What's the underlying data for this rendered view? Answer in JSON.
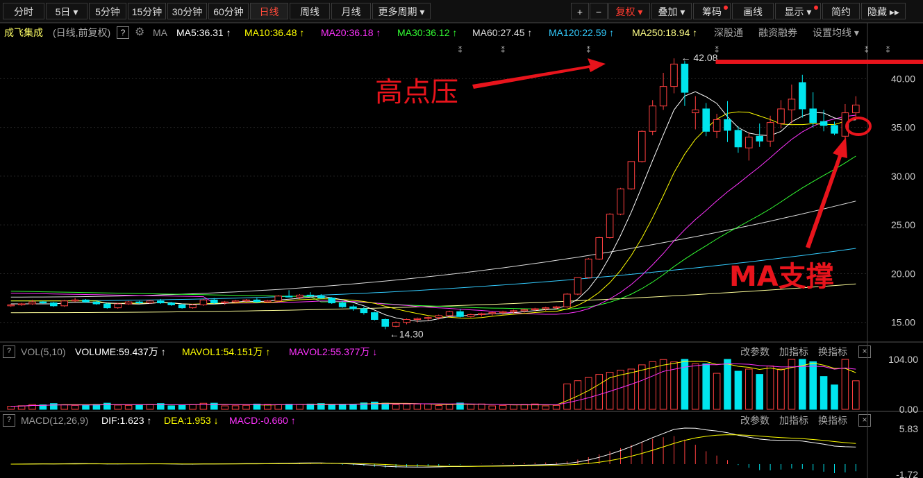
{
  "toolbar": {
    "tabs": [
      {
        "label": "分时",
        "name": "tab-intraday"
      },
      {
        "label": "5日 ▾",
        "name": "tab-5day"
      },
      {
        "label": "5分钟",
        "name": "tab-5min"
      },
      {
        "label": "15分钟",
        "name": "tab-15min"
      },
      {
        "label": "30分钟",
        "name": "tab-30min"
      },
      {
        "label": "60分钟",
        "name": "tab-60min"
      },
      {
        "label": "日线",
        "name": "tab-daily"
      },
      {
        "label": "周线",
        "name": "tab-weekly"
      },
      {
        "label": "月线",
        "name": "tab-monthly"
      },
      {
        "label": "更多周期 ▾",
        "name": "tab-more-periods"
      }
    ],
    "active_tab": "日线",
    "zoom_in": "+",
    "zoom_out": "−",
    "adjust": "复权 ▾",
    "overlay": "叠加 ▾",
    "chips": "筹码",
    "draw": "画线",
    "display": "显示 ▾",
    "simple": "简约",
    "hide": "隐藏 ▸▸"
  },
  "main": {
    "stock_name": "成飞集成",
    "mode": "(日线,前复权)",
    "help": "?",
    "ma_label": "MA",
    "ma_values": [
      {
        "text": "MA5:36.31 ↑",
        "color": "#ffffff"
      },
      {
        "text": "MA10:36.48 ↑",
        "color": "#ffff00"
      },
      {
        "text": "MA20:36.18 ↑",
        "color": "#ff33ff"
      },
      {
        "text": "MA30:36.12 ↑",
        "color": "#33ff33"
      },
      {
        "text": "MA60:27.45 ↑",
        "color": "#dddddd"
      },
      {
        "text": "MA120:22.59 ↑",
        "color": "#33ccff"
      },
      {
        "text": "MA250:18.94 ↑",
        "color": "#ffff88"
      }
    ],
    "links": [
      "深股通",
      "融资融券",
      "设置均线 ▾"
    ],
    "high_label": "42.08",
    "low_label": "14.30",
    "annotation_high": "高点压",
    "annotation_ma": "MA支撑"
  },
  "volume": {
    "label": "VOL(5,10)",
    "volume": "VOLUME:59.437万 ↑",
    "mavol1": "MAVOL1:54.151万 ↑",
    "mavol2": "MAVOL2:55.377万 ↓",
    "buttons": [
      "改参数",
      "加指标",
      "换指标"
    ],
    "close": "×"
  },
  "macd": {
    "label": "MACD(12,26,9)",
    "dif": "DIF:1.623 ↑",
    "dea": "DEA:1.953 ↓",
    "macd": "MACD:-0.660 ↑",
    "buttons": [
      "改参数",
      "加指标",
      "换指标"
    ],
    "close": "×"
  },
  "colors": {
    "up": "#ff4040",
    "down": "#00e5ee",
    "annotation": "#e8141c"
  },
  "chart_data": [
    {
      "type": "candlestick",
      "title": "成飞集成 (日线,前复权)",
      "y_ticks": [
        15.0,
        20.0,
        25.0,
        30.0,
        35.0,
        40.0
      ],
      "ylim": [
        13.2,
        43.8
      ],
      "days": 80,
      "price_high": 42.08,
      "price_low": 14.3,
      "ohlc": [
        [
          16.7,
          16.9,
          16.6,
          16.8
        ],
        [
          16.8,
          17.0,
          16.7,
          16.9
        ],
        [
          16.9,
          17.3,
          16.8,
          17.1
        ],
        [
          17.1,
          17.2,
          16.9,
          17.0
        ],
        [
          17.0,
          17.1,
          16.6,
          16.7
        ],
        [
          16.7,
          17.3,
          16.6,
          17.2
        ],
        [
          17.2,
          17.5,
          17.1,
          17.3
        ],
        [
          17.3,
          17.4,
          17.0,
          17.1
        ],
        [
          17.1,
          17.2,
          16.8,
          16.9
        ],
        [
          16.9,
          17.0,
          16.4,
          16.5
        ],
        [
          16.5,
          17.0,
          16.4,
          16.9
        ],
        [
          16.9,
          17.2,
          16.8,
          17.1
        ],
        [
          17.1,
          17.2,
          16.9,
          17.0
        ],
        [
          17.0,
          17.3,
          16.9,
          17.2
        ],
        [
          17.2,
          17.4,
          16.9,
          17.0
        ],
        [
          17.0,
          17.1,
          16.7,
          16.8
        ],
        [
          16.8,
          16.9,
          16.4,
          16.5
        ],
        [
          16.5,
          16.9,
          16.4,
          16.8
        ],
        [
          16.8,
          17.4,
          16.7,
          17.3
        ],
        [
          17.3,
          17.5,
          16.9,
          17.0
        ],
        [
          17.0,
          17.2,
          16.8,
          17.1
        ],
        [
          17.1,
          17.3,
          17.0,
          17.2
        ],
        [
          17.2,
          17.4,
          17.1,
          17.3
        ],
        [
          17.3,
          17.5,
          17.0,
          17.1
        ],
        [
          17.1,
          17.3,
          17.0,
          17.2
        ],
        [
          17.2,
          17.8,
          17.1,
          17.7
        ],
        [
          17.7,
          18.3,
          17.6,
          17.6
        ],
        [
          17.6,
          17.9,
          17.4,
          17.8
        ],
        [
          17.8,
          18.1,
          17.6,
          17.7
        ],
        [
          17.7,
          17.9,
          17.4,
          17.5
        ],
        [
          17.5,
          17.6,
          16.9,
          17.0
        ],
        [
          17.0,
          17.2,
          16.5,
          16.6
        ],
        [
          16.6,
          16.8,
          16.2,
          16.4
        ],
        [
          16.4,
          16.6,
          15.8,
          16.0
        ],
        [
          16.0,
          16.1,
          15.2,
          15.3
        ],
        [
          15.3,
          15.4,
          14.3,
          14.6
        ],
        [
          14.6,
          15.1,
          14.5,
          15.0
        ],
        [
          15.0,
          15.4,
          14.8,
          15.3
        ],
        [
          15.3,
          15.5,
          15.0,
          15.4
        ],
        [
          15.4,
          15.6,
          15.2,
          15.5
        ],
        [
          15.5,
          15.8,
          15.3,
          15.7
        ],
        [
          15.7,
          16.2,
          15.6,
          16.1
        ],
        [
          16.1,
          16.4,
          15.5,
          15.6
        ],
        [
          15.6,
          15.9,
          15.5,
          15.8
        ],
        [
          15.8,
          16.0,
          15.6,
          15.9
        ],
        [
          15.9,
          16.1,
          15.7,
          16.0
        ],
        [
          16.0,
          16.2,
          15.8,
          16.1
        ],
        [
          16.1,
          16.3,
          15.9,
          16.2
        ],
        [
          16.2,
          16.4,
          16.0,
          16.3
        ],
        [
          16.3,
          16.5,
          16.1,
          16.4
        ],
        [
          16.4,
          16.6,
          16.2,
          16.5
        ],
        [
          16.5,
          16.7,
          16.3,
          16.6
        ],
        [
          16.6,
          18.0,
          16.5,
          17.9
        ],
        [
          17.9,
          19.6,
          17.8,
          19.6
        ],
        [
          19.6,
          21.6,
          19.5,
          21.5
        ],
        [
          21.5,
          23.8,
          21.4,
          23.7
        ],
        [
          23.7,
          26.2,
          23.6,
          26.1
        ],
        [
          26.1,
          28.8,
          26.0,
          28.7
        ],
        [
          28.7,
          31.5,
          28.6,
          31.5
        ],
        [
          31.5,
          34.7,
          31.4,
          34.6
        ],
        [
          34.6,
          37.8,
          34.2,
          37.2
        ],
        [
          37.2,
          40.6,
          36.8,
          39.2
        ],
        [
          39.2,
          42.08,
          38.5,
          41.5
        ],
        [
          41.5,
          41.8,
          37.2,
          38.6
        ],
        [
          36.5,
          38.2,
          34.8,
          36.8
        ],
        [
          36.9,
          37.5,
          34.1,
          34.6
        ],
        [
          34.6,
          36.4,
          33.9,
          35.8
        ],
        [
          35.8,
          37.7,
          33.5,
          34.7
        ],
        [
          34.7,
          35.1,
          32.4,
          33.0
        ],
        [
          32.9,
          34.5,
          31.6,
          34.0
        ],
        [
          34.1,
          35.4,
          33.0,
          33.6
        ],
        [
          33.6,
          36.2,
          33.0,
          35.5
        ],
        [
          35.4,
          37.8,
          34.9,
          36.9
        ],
        [
          36.8,
          39.4,
          35.4,
          37.9
        ],
        [
          39.6,
          40.4,
          36.0,
          36.9
        ],
        [
          36.9,
          38.6,
          35.0,
          35.5
        ],
        [
          35.6,
          36.8,
          34.6,
          35.2
        ],
        [
          35.2,
          35.6,
          34.2,
          34.4
        ],
        [
          34.1,
          37.4,
          33.5,
          36.5
        ],
        [
          36.5,
          38.2,
          35.8,
          37.3
        ]
      ]
    },
    {
      "type": "bar",
      "title": "VOL(5,10)",
      "y_ticks": [
        0.0,
        104.0
      ],
      "unit": "万",
      "last_volume": 59.437,
      "mavol1": 54.151,
      "mavol2": 55.377
    },
    {
      "type": "line",
      "title": "MACD(12,26,9)",
      "y_ticks": [
        5.83,
        -1.72
      ],
      "dif": 1.623,
      "dea": 1.953,
      "macd": -0.66
    }
  ]
}
